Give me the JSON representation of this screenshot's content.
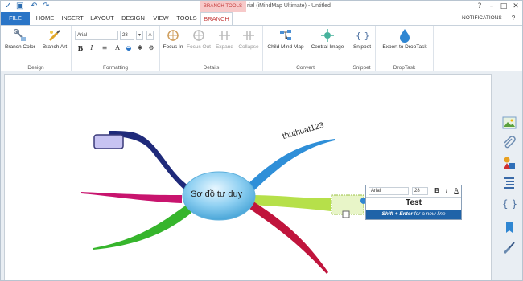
{
  "window": {
    "context_tab": "BRANCH TOOLS",
    "title": "rial (iMindMap Ultimate) - Untitled",
    "minimize": "–",
    "maximize": "□",
    "close": "✕"
  },
  "tabs": {
    "file": "FILE",
    "items": [
      "HOME",
      "INSERT",
      "LAYOUT",
      "DESIGN",
      "VIEW",
      "TOOLS",
      "BRANCH"
    ],
    "notifications": "NOTIFICATIONS",
    "help": "?"
  },
  "ribbon": {
    "design": {
      "label": "Design",
      "branch_color": "Branch Color",
      "branch_art": "Branch Art"
    },
    "formatting": {
      "label": "Formatting",
      "font": "Arial",
      "size": "28",
      "bold": "B",
      "italic": "I"
    },
    "details": {
      "label": "Details",
      "focus_in": "Focus In",
      "focus_out": "Focus Out",
      "expand": "Expand",
      "collapse": "Collapse"
    },
    "convert": {
      "label": "Convert",
      "child_mind_map": "Child Mind Map",
      "central_image": "Central Image"
    },
    "snippet": {
      "label": "Snippet",
      "snippet": "Snippet"
    },
    "droptask": {
      "label": "DropTask",
      "export": "Export to DropTask"
    }
  },
  "mindmap": {
    "central_topic": "Sơ đồ tư duy",
    "branch_label": "thuthuat123",
    "colors": {
      "navy": "#1f2a7a",
      "magenta": "#c8146e",
      "green": "#36b52c",
      "blue": "#2f8fd8",
      "lime": "#b6e04a",
      "crimson": "#c0143c",
      "center": "#7cc6ee"
    }
  },
  "editor": {
    "font": "Arial",
    "size": "28",
    "bold": "B",
    "italic": "I",
    "underline": "A",
    "text": "Test",
    "hint_bold": "Shift + Enter",
    "hint_rest": " for a new line"
  },
  "sidebar": [
    "image-icon",
    "attachment-icon",
    "shapes-icon",
    "list-icon",
    "snippet-icon",
    "tag-icon",
    "brush-icon"
  ]
}
